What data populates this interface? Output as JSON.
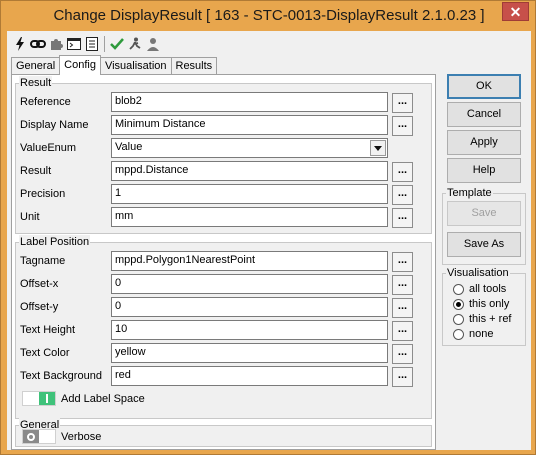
{
  "window": {
    "title": "Change DisplayResult [ 163 - STC-0013-DisplayResult 2.1.0.23 ]",
    "close_glyph": "✕"
  },
  "toolbar": {
    "icons": [
      "lightning-icon",
      "link-icon",
      "puzzle-icon",
      "console-icon",
      "notes-icon",
      "checkmark-icon",
      "run-icon",
      "person-icon"
    ]
  },
  "tabs": [
    "General",
    "Config",
    "Visualisation",
    "Results"
  ],
  "active_tab": "Config",
  "result_group": {
    "title": "Result",
    "rows": [
      {
        "label": "Reference",
        "value": "blob2",
        "dots": "..."
      },
      {
        "label": "Display Name",
        "value": "Minimum Distance",
        "dots": "..."
      },
      {
        "label": "ValueEnum",
        "value": "Value"
      },
      {
        "label": "Result",
        "value": "mppd.Distance",
        "dots": "..."
      },
      {
        "label": "Precision",
        "value": "1",
        "dots": "..."
      },
      {
        "label": "Unit",
        "value": "mm",
        "dots": "..."
      }
    ]
  },
  "label_position_group": {
    "title": "Label Position",
    "rows": [
      {
        "label": "Tagname",
        "value": "mppd.Polygon1NearestPoint",
        "dots": "..."
      },
      {
        "label": "Offset-x",
        "value": "0",
        "dots": "..."
      },
      {
        "label": "Offset-y",
        "value": "0",
        "dots": "..."
      },
      {
        "label": "Text Height",
        "value": "10",
        "dots": "..."
      },
      {
        "label": "Text Color",
        "value": "yellow",
        "dots": "..."
      },
      {
        "label": "Text Background",
        "value": "red",
        "dots": "..."
      }
    ],
    "add_label_space": {
      "label": "Add Label Space",
      "on": true
    }
  },
  "general_group": {
    "title": "General",
    "verbose": {
      "label": "Verbose",
      "on": false
    }
  },
  "buttons": {
    "ok": "OK",
    "cancel": "Cancel",
    "apply": "Apply",
    "help": "Help"
  },
  "template_group": {
    "title": "Template",
    "save": "Save",
    "save_as": "Save As"
  },
  "visualisation_group": {
    "title": "Visualisation",
    "options": [
      "all tools",
      "this only",
      "this + ref",
      "none"
    ],
    "selected": "this only"
  },
  "colors": {
    "title_bar": "#e8a64d",
    "toggle_on": "#3fc27a",
    "default_button_border": "#3c7fb1"
  }
}
